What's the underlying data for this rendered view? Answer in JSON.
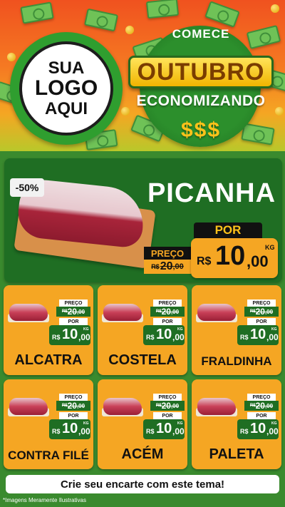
{
  "header": {
    "logo_lines": [
      "SUA",
      "LOGO",
      "AQUI"
    ],
    "comece": "COMECE",
    "month": "OUTUBRO",
    "economizando": "ECONOMIZANDO",
    "dollars": "$$$"
  },
  "hero": {
    "discount": "-50%",
    "product": "PICANHA",
    "preco_label": "PREÇO",
    "old_currency": "R$",
    "old_int": "20",
    "old_dec": ",00",
    "por_label": "POR",
    "currency": "R$",
    "price_int": "10",
    "price_dec": ",00",
    "unit": "KG"
  },
  "products": [
    {
      "name": "ALCATRA",
      "preco_label": "PREÇO",
      "old_currency": "R$",
      "old_int": "20",
      "old_dec": ",00",
      "por_label": "POR",
      "currency": "R$",
      "price_int": "10",
      "price_dec": ",00",
      "unit": "KG"
    },
    {
      "name": "COSTELA",
      "preco_label": "PREÇO",
      "old_currency": "R$",
      "old_int": "20",
      "old_dec": ",00",
      "por_label": "POR",
      "currency": "R$",
      "price_int": "10",
      "price_dec": ",00",
      "unit": "KG"
    },
    {
      "name": "FRALDINHA",
      "preco_label": "PREÇO",
      "old_currency": "R$",
      "old_int": "20",
      "old_dec": ",00",
      "por_label": "POR",
      "currency": "R$",
      "price_int": "10",
      "price_dec": ",00",
      "unit": "KG"
    },
    {
      "name": "CONTRA FILÉ",
      "preco_label": "PREÇO",
      "old_currency": "R$",
      "old_int": "20",
      "old_dec": ",00",
      "por_label": "POR",
      "currency": "R$",
      "price_int": "10",
      "price_dec": ",00",
      "unit": "KG"
    },
    {
      "name": "ACÉM",
      "preco_label": "PREÇO",
      "old_currency": "R$",
      "old_int": "20",
      "old_dec": ",00",
      "por_label": "POR",
      "currency": "R$",
      "price_int": "10",
      "price_dec": ",00",
      "unit": "KG"
    },
    {
      "name": "PALETA",
      "preco_label": "PREÇO",
      "old_currency": "R$",
      "old_int": "20",
      "old_dec": ",00",
      "por_label": "POR",
      "currency": "R$",
      "price_int": "10",
      "price_dec": ",00",
      "unit": "KG"
    }
  ],
  "footer": {
    "cta": "Crie seu encarte com este tema!",
    "disclaimer": "*Imagens Meramente Ilustrativas"
  },
  "colors": {
    "header_orange": "#f0521f",
    "accent_yellow": "#f5a623",
    "brand_green": "#1f6e23",
    "background_green": "#3a8a2e"
  }
}
